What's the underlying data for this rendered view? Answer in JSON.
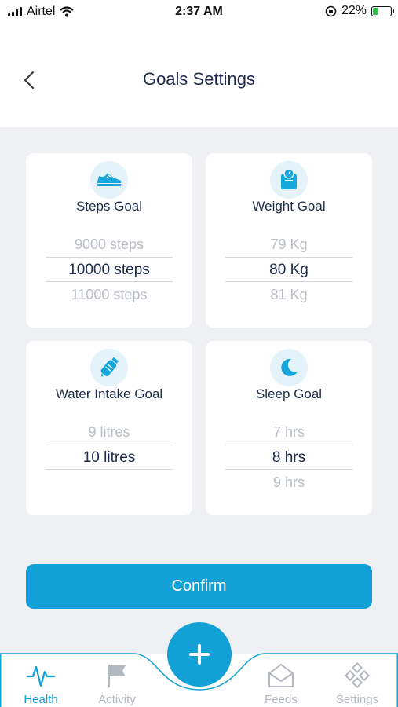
{
  "status_bar": {
    "carrier": "Airtel",
    "time": "2:37 AM",
    "battery": "22%"
  },
  "header": {
    "title": "Goals Settings"
  },
  "cards": [
    {
      "title": "Steps Goal",
      "icon": "shoe-icon",
      "options": [
        "9000 steps",
        "10000 steps",
        "11000 steps"
      ]
    },
    {
      "title": "Weight Goal",
      "icon": "scale-icon",
      "options": [
        "79 Kg",
        "80 Kg",
        "81 Kg"
      ]
    },
    {
      "title": "Water Intake Goal",
      "icon": "water-bottle-icon",
      "options": [
        "9 litres",
        "10 litres",
        ""
      ]
    },
    {
      "title": "Sleep Goal",
      "icon": "moon-icon",
      "options": [
        "7 hrs",
        "8 hrs",
        "9 hrs"
      ]
    }
  ],
  "confirm_label": "Confirm",
  "tabs": [
    {
      "label": "Health",
      "icon": "heartbeat-icon",
      "active": true
    },
    {
      "label": "Activity",
      "icon": "flag-icon",
      "active": false
    },
    {
      "label": "Feeds",
      "icon": "envelope-icon",
      "active": false
    },
    {
      "label": "Settings",
      "icon": "settings-grid-icon",
      "active": false
    }
  ],
  "colors": {
    "accent": "#11a1d6",
    "background": "#eef0f3",
    "title": "#1c2a4e",
    "inactive": "#b3b7bf"
  }
}
